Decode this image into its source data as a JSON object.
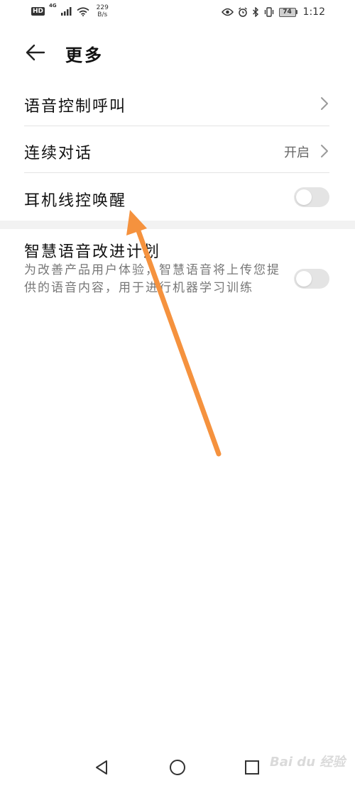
{
  "status_bar": {
    "badge": "HD",
    "network": "4G",
    "speed_value": "229",
    "speed_unit": "B/s",
    "battery": "74",
    "time": "1:12",
    "icons": [
      "eye-icon",
      "alarm-icon",
      "bluetooth-icon",
      "vibrate-icon"
    ]
  },
  "header": {
    "title": "更多",
    "back_icon": "arrow-left-icon"
  },
  "settings": {
    "voice_call": {
      "label": "语音控制呼叫"
    },
    "continuous": {
      "label": "连续对话",
      "value": "开启"
    },
    "wired_wake": {
      "label": "耳机线控唤醒",
      "enabled": false
    },
    "improve": {
      "label": "智慧语音改进计划",
      "description": "为改善产品用户体验，智慧语音将上传您提供的语音内容，用于进行机器学习训练",
      "enabled": false
    }
  },
  "nav": {
    "icons": [
      "back-triangle-icon",
      "home-circle-icon",
      "recents-square-icon"
    ]
  },
  "watermark": "Bai du 经验",
  "colors": {
    "annotation_arrow": "#F5923E",
    "toggle_off": "#E4E4E4"
  }
}
